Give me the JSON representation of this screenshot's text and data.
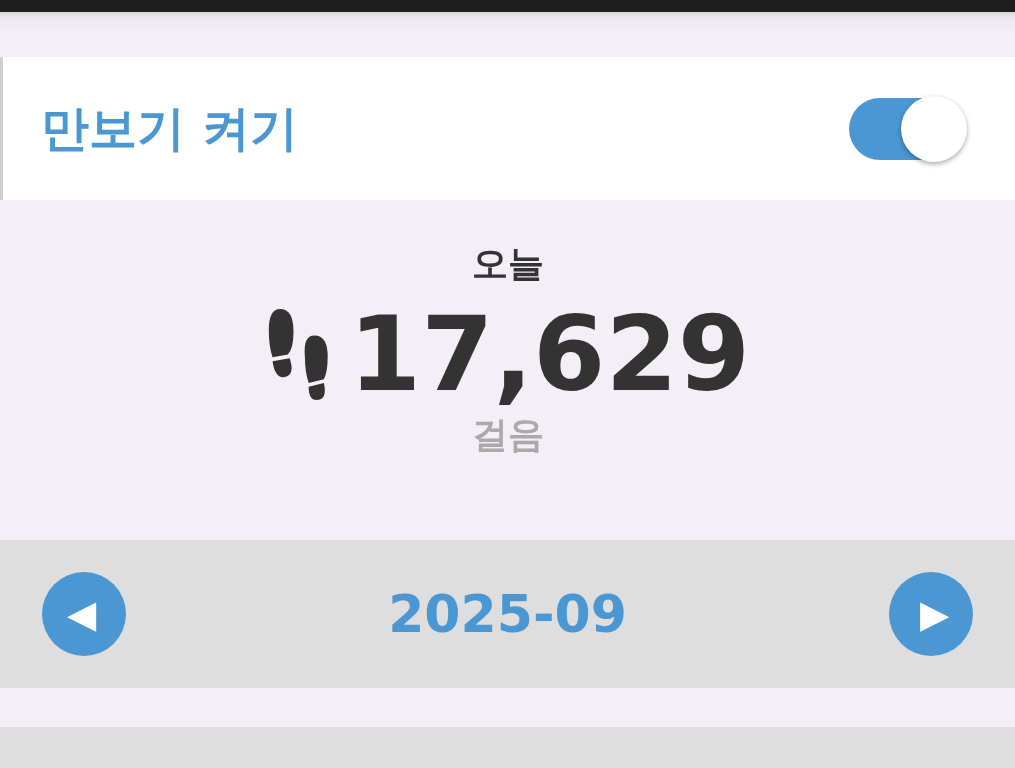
{
  "pedometer": {
    "label": "만보기 켜기",
    "on": true
  },
  "today": {
    "title": "오늘",
    "steps": "17,629",
    "unit": "걸음"
  },
  "month_nav": {
    "prev": "◀",
    "month": "2025-09",
    "next": "▶"
  }
}
